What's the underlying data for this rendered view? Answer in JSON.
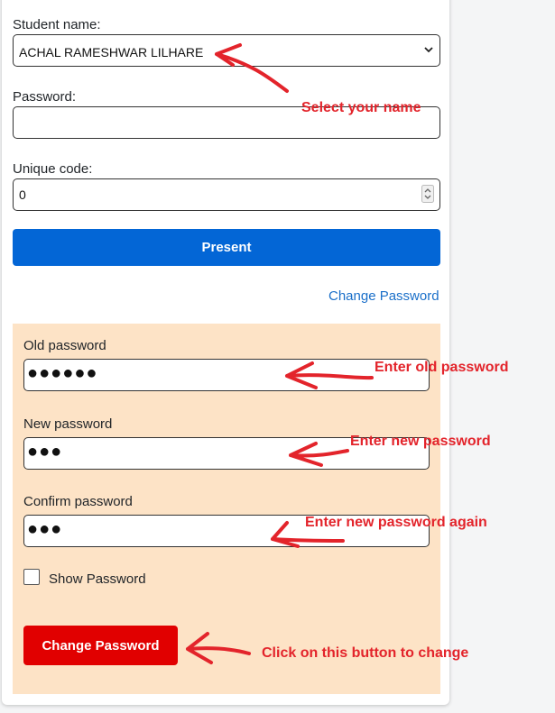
{
  "form": {
    "student_label": "Student name:",
    "student_value": "ACHAL RAMESHWAR LILHARE",
    "password_label": "Password:",
    "code_label": "Unique code:",
    "code_value": "0",
    "present_label": "Present",
    "change_link": "Change Password"
  },
  "change_panel": {
    "old_label": "Old password",
    "old_mask": "●●●●●●",
    "new_label": "New password",
    "new_mask": "●●●",
    "confirm_label": "Confirm password",
    "confirm_mask": "●●●",
    "show_label": "Show Password",
    "show_checked": false,
    "button_label": "Change Password",
    "panel_color": "#fde3c6"
  },
  "annotations": {
    "select_name": "Select your name",
    "old_password": "Enter old password",
    "new_password": "Enter new password",
    "new_again": "Enter new password again",
    "click_button": "Click on this button to change",
    "color": "#e3242b"
  },
  "colors": {
    "primary": "#0366d6",
    "danger": "#e10000",
    "link": "#1a6fc9"
  }
}
